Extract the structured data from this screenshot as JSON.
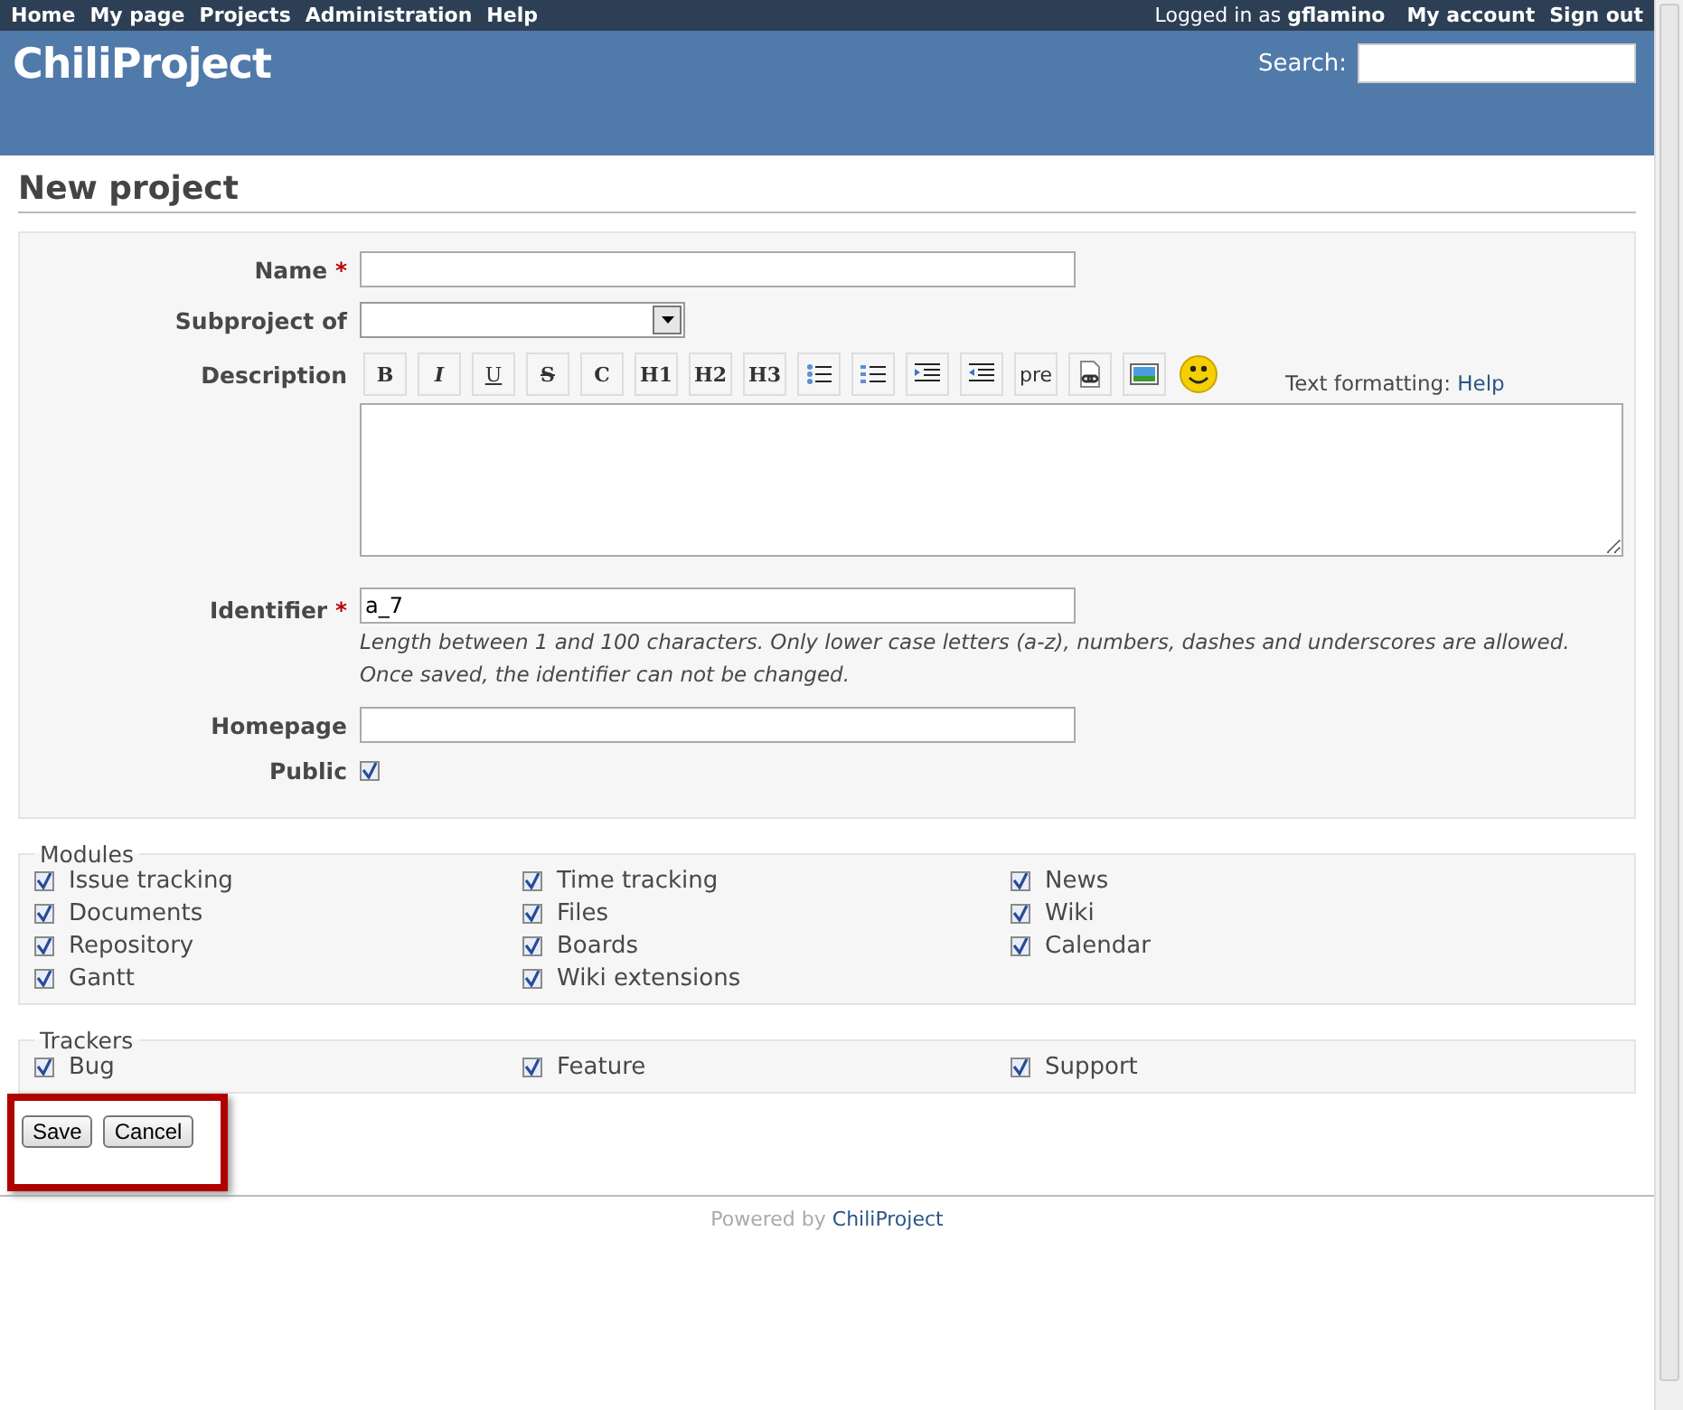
{
  "top_menu": {
    "left": [
      "Home",
      "My page",
      "Projects",
      "Administration",
      "Help"
    ],
    "logged_in_prefix": "Logged in as",
    "user": "gflamino",
    "right": [
      "My account",
      "Sign out"
    ]
  },
  "header": {
    "title": "ChiliProject",
    "search_label": "Search:"
  },
  "page_title": "New project",
  "form": {
    "name": {
      "label": "Name",
      "required_mark": "*"
    },
    "subproject": {
      "label": "Subproject of"
    },
    "description": {
      "label": "Description",
      "toolbar": [
        {
          "kind": "bold",
          "label": "B"
        },
        {
          "kind": "italic",
          "label": "I"
        },
        {
          "kind": "underline",
          "label": "U"
        },
        {
          "kind": "strike",
          "label": "S"
        },
        {
          "kind": "code",
          "label": "C"
        },
        {
          "kind": "heading",
          "label": "H1"
        },
        {
          "kind": "heading",
          "label": "H2"
        },
        {
          "kind": "heading",
          "label": "H3"
        },
        {
          "kind": "ul"
        },
        {
          "kind": "ol"
        },
        {
          "kind": "indent"
        },
        {
          "kind": "outdent"
        },
        {
          "kind": "pre",
          "label": "pre"
        },
        {
          "kind": "link"
        },
        {
          "kind": "image"
        },
        {
          "kind": "smiley"
        }
      ],
      "formatting_label": "Text formatting:",
      "help_link": "Help"
    },
    "identifier": {
      "label": "Identifier",
      "required_mark": "*",
      "value": "a_7",
      "hint_1": "Length between 1 and 100 characters. Only lower case letters (a-z), numbers, dashes and underscores are allowed.",
      "hint_2": "Once saved, the identifier can not be changed."
    },
    "homepage": {
      "label": "Homepage"
    },
    "public": {
      "label": "Public",
      "checked": true
    }
  },
  "modules": {
    "legend": "Modules",
    "items": [
      {
        "label": "Issue tracking",
        "checked": true
      },
      {
        "label": "Time tracking",
        "checked": true
      },
      {
        "label": "News",
        "checked": true
      },
      {
        "label": "Documents",
        "checked": true
      },
      {
        "label": "Files",
        "checked": true
      },
      {
        "label": "Wiki",
        "checked": true
      },
      {
        "label": "Repository",
        "checked": true
      },
      {
        "label": "Boards",
        "checked": true
      },
      {
        "label": "Calendar",
        "checked": true
      },
      {
        "label": "Gantt",
        "checked": true
      },
      {
        "label": "Wiki extensions",
        "checked": true
      }
    ]
  },
  "trackers": {
    "legend": "Trackers",
    "items": [
      {
        "label": "Bug",
        "checked": true
      },
      {
        "label": "Feature",
        "checked": true
      },
      {
        "label": "Support",
        "checked": true
      }
    ]
  },
  "buttons": [
    "Save",
    "Cancel"
  ],
  "footer": {
    "prefix": "Powered by",
    "link": "ChiliProject"
  }
}
